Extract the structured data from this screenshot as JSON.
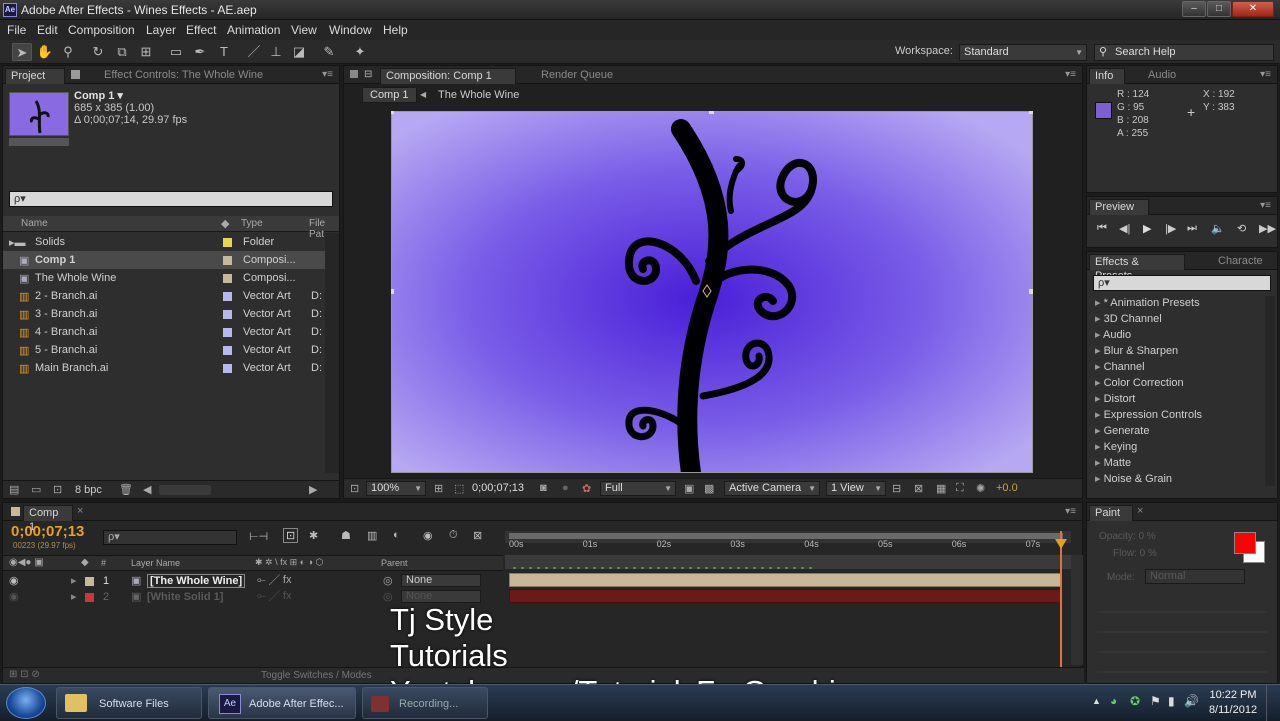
{
  "window": {
    "title": "Adobe After Effects - Wines Effects - AE.aep",
    "app_icon": "Ae"
  },
  "menu": [
    "File",
    "Edit",
    "Composition",
    "Layer",
    "Effect",
    "Animation",
    "View",
    "Window",
    "Help"
  ],
  "toolbar": {
    "workspace_label": "Workspace:",
    "workspace_value": "Standard",
    "search_placeholder": "Search Help"
  },
  "project": {
    "tabs": [
      "Project",
      "Effect Controls: The Whole Wine"
    ],
    "comp_name": "Comp 1 ▾",
    "comp_size": "685 x 385 (1.00)",
    "comp_duration": "Δ 0;00;07;14, 29.97 fps",
    "search_placeholder": "ρ▾",
    "columns": {
      "name": "Name",
      "type": "Type",
      "path": "File Pat"
    },
    "items": [
      {
        "name": "Solids",
        "type": "Folder",
        "path": "",
        "color": "#e6d84a",
        "icon": "folder-icon"
      },
      {
        "name": "Comp 1",
        "type": "Composi...",
        "path": "",
        "color": "#c8b89a",
        "icon": "composition-icon"
      },
      {
        "name": "The Whole Wine",
        "type": "Composi...",
        "path": "",
        "color": "#c8b89a",
        "icon": "composition-icon"
      },
      {
        "name": "2 - Branch.ai",
        "type": "Vector Art",
        "path": "D:",
        "color": "#b8b8ee",
        "icon": "ai-file-icon"
      },
      {
        "name": "3 - Branch.ai",
        "type": "Vector Art",
        "path": "D:",
        "color": "#b8b8ee",
        "icon": "ai-file-icon"
      },
      {
        "name": "4 - Branch.ai",
        "type": "Vector Art",
        "path": "D:",
        "color": "#b8b8ee",
        "icon": "ai-file-icon"
      },
      {
        "name": "5 - Branch.ai",
        "type": "Vector Art",
        "path": "D:",
        "color": "#b8b8ee",
        "icon": "ai-file-icon"
      },
      {
        "name": "Main Branch.ai",
        "type": "Vector Art",
        "path": "D:",
        "color": "#b8b8ee",
        "icon": "ai-file-icon"
      }
    ],
    "bpc": "8 bpc"
  },
  "composition": {
    "tabs": [
      "Composition: Comp 1",
      "Render Queue"
    ],
    "breadcrumbs": [
      "Comp 1",
      "The Whole Wine"
    ],
    "zoom": "100%",
    "timecode": "0;00;07;13",
    "resolution": "Full",
    "camera": "Active Camera",
    "views": "1 View",
    "exposure": "+0.0"
  },
  "info": {
    "tabs": [
      "Info",
      "Audio"
    ],
    "r": "R : 124",
    "g": "G : 95",
    "b": "B : 208",
    "a": "A : 255",
    "x": "X : 192",
    "y": "Y : 383",
    "swatch": "#7c5fd0"
  },
  "preview": {
    "title": "Preview"
  },
  "effects": {
    "tabs": [
      "Effects & Presets",
      "Characte"
    ],
    "search_placeholder": "ρ▾",
    "items": [
      "* Animation Presets",
      "3D Channel",
      "Audio",
      "Blur & Sharpen",
      "Channel",
      "Color Correction",
      "Distort",
      "Expression Controls",
      "Generate",
      "Keying",
      "Matte",
      "Noise & Grain"
    ]
  },
  "timeline": {
    "tab": "Comp 1",
    "timecode": "0;00;07;13",
    "frames": "00223 (29.97 fps)",
    "search_placeholder": "ρ▾",
    "col_layer": "Layer Name",
    "col_num": "#",
    "col_parent": "Parent",
    "ruler": [
      "00s",
      "01s",
      "02s",
      "03s",
      "04s",
      "05s",
      "06s",
      "07s"
    ],
    "layers": [
      {
        "num": "1",
        "name": "[The Whole Wine]",
        "parent": "None",
        "color": "#c8b89a"
      },
      {
        "num": "2",
        "name": "[White Solid 1]",
        "parent": "None",
        "color": "#c83a3a"
      }
    ],
    "toggle_label": "Toggle Switches / Modes"
  },
  "paint": {
    "title": "Paint",
    "opacity": "Opacity: 0 %",
    "flow": "Flow: 0 %",
    "mode_label": "Mode:",
    "mode": "Normal",
    "fg": "#ff0000",
    "bg": "#ffffff"
  },
  "overlay": {
    "line1": "Tj Style",
    "line2": "Tutorials",
    "line3": "Youtube.com/TutorialsForGraphics"
  },
  "taskbar": {
    "items": [
      "Software Files",
      "Adobe After Effec...",
      "Recording..."
    ],
    "time": "10:22 PM",
    "date": "8/11/2012"
  }
}
